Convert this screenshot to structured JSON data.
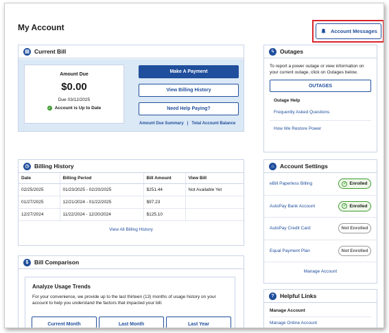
{
  "page": {
    "title": "My Account"
  },
  "header": {
    "account_messages": "Account Messages"
  },
  "current_bill": {
    "title": "Current Bill",
    "amount_label": "Amount Due",
    "amount": "$0.00",
    "due": "Due 03/12/2025",
    "status": "Account is Up to Date",
    "make_payment": "Make A Payment",
    "view_history": "View Billing History",
    "need_help": "Need Help Paying?",
    "link_summary": "Amount Due Summary",
    "link_separator": "|",
    "link_balance": "Total Account Balance"
  },
  "billing_history": {
    "title": "Billing History",
    "columns": [
      "Date",
      "Billing Period",
      "Bill Amount",
      "View Bill"
    ],
    "rows": [
      [
        "02/25/2025",
        "01/23/2025 - 02/20/2025",
        "$251.44",
        "Not Available Yet"
      ],
      [
        "01/27/2025",
        "12/21/2024 - 01/22/2025",
        "$97.23",
        ""
      ],
      [
        "12/27/2024",
        "11/22/2024 - 12/20/2024",
        "$125.10",
        ""
      ]
    ],
    "view_all": "View All Billing History"
  },
  "bill_comparison": {
    "title": "Bill Comparison",
    "analyze_title": "Analyze Usage Trends",
    "analyze_text": "For your convenience, we provide up to the last thirteen (13) months of usage history on your account to help you understand the factors that impacted your bill.",
    "tabs": [
      "Current Month",
      "Last Month",
      "Last Year"
    ]
  },
  "outages": {
    "title": "Outages",
    "text": "To report a power outage or view information on your current outage, click on Outages below.",
    "button": "OUTAGES",
    "help_title": "Outage Help",
    "links": [
      "Frequently Asked Questions",
      "How We Restore Power"
    ]
  },
  "account_settings": {
    "title": "Account Settings",
    "items": [
      {
        "label": "eBill Paperless Billing",
        "status": "Enrolled"
      },
      {
        "label": "AutoPay Bank Account",
        "status": "Enrolled"
      },
      {
        "label": "AutoPay Credit Card",
        "status": "Not Enrolled"
      },
      {
        "label": "Equal Payment Plan",
        "status": "Not Enrolled"
      }
    ],
    "manage": "Manage Account"
  },
  "helpful_links": {
    "title": "Helpful Links",
    "subtitle": "Manage Account",
    "links": [
      "Manage Online Account"
    ]
  },
  "colors": {
    "primary": "#1f4e9c",
    "panel": "#dbe8f5",
    "enrolled": "#3c9a2f",
    "highlight": "#d8232a"
  }
}
